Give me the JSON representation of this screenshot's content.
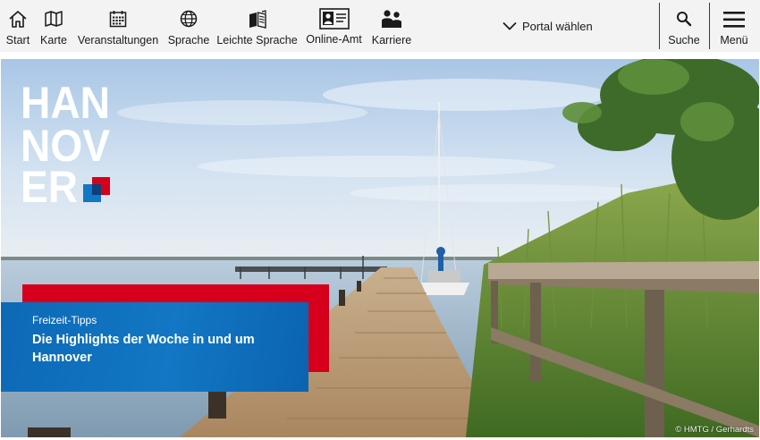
{
  "nav": {
    "items": [
      {
        "label": "Start",
        "icon": "home-icon"
      },
      {
        "label": "Karte",
        "icon": "map-icon"
      },
      {
        "label": "Veranstaltungen",
        "icon": "calendar-icon"
      },
      {
        "label": "Sprache",
        "icon": "globe-icon"
      },
      {
        "label": "Leichte Sprache",
        "icon": "book-icon"
      },
      {
        "label": "Online-Amt",
        "icon": "id-card-icon"
      },
      {
        "label": "Karriere",
        "icon": "people-icon"
      }
    ],
    "portal_label": "Portal wählen",
    "search_label": "Suche",
    "menu_label": "Menü"
  },
  "hero": {
    "logo_text": [
      "HAN",
      "NOV",
      "ER"
    ],
    "teaser": {
      "kicker": "Freizeit-Tipps",
      "title": "Die Highlights der Woche in und um Hannover"
    },
    "credit": "© HMTG / Gerhardts"
  },
  "colors": {
    "brand_red": "#d6001c",
    "brand_blue": "#0d69b6",
    "nav_bg": "#f3f3f3"
  }
}
